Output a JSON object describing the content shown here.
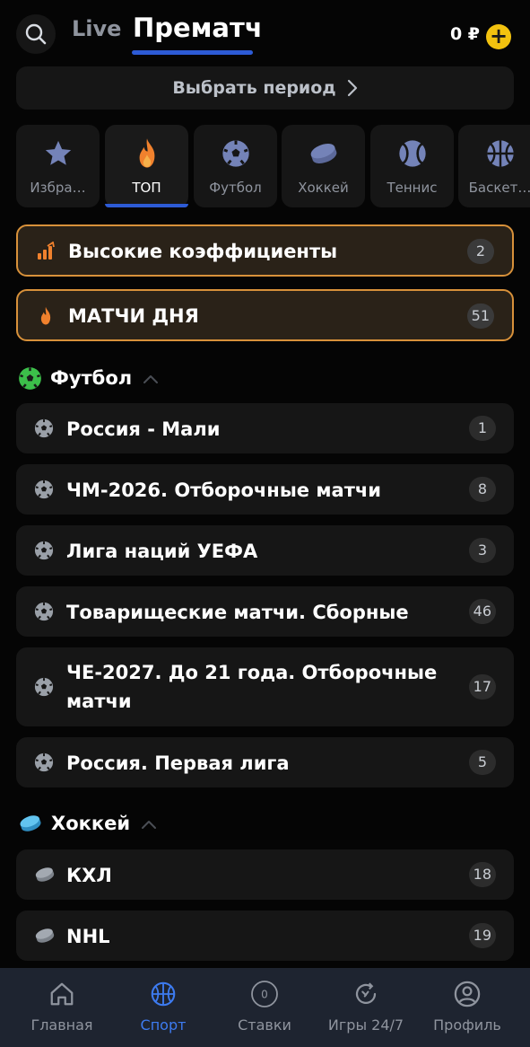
{
  "header": {
    "tabs": [
      {
        "label": "Live",
        "active": false
      },
      {
        "label": "Прематч",
        "active": true
      }
    ],
    "balance": "0 ₽",
    "accent_color": "#2d5bd6",
    "plus_color": "#f2c20f"
  },
  "period": {
    "label": "Выбрать период"
  },
  "sports": [
    {
      "label": "Избра…",
      "icon": "star-icon",
      "active": false
    },
    {
      "label": "ТОП",
      "icon": "flame-icon",
      "active": true
    },
    {
      "label": "Футбол",
      "icon": "soccer-ball-icon",
      "active": false
    },
    {
      "label": "Хоккей",
      "icon": "hockey-puck-icon",
      "active": false
    },
    {
      "label": "Теннис",
      "icon": "tennis-ball-icon",
      "active": false
    },
    {
      "label": "Баскет…",
      "icon": "basketball-icon",
      "active": false
    }
  ],
  "highlights": [
    {
      "label": "Высокие коэффициенты",
      "count": "2",
      "icon": "bar-chart-icon"
    },
    {
      "label": "МАТЧИ ДНЯ",
      "count": "51",
      "icon": "flame-icon"
    }
  ],
  "sections": [
    {
      "title": "Футбол",
      "icon": "soccer-ball-icon",
      "items": [
        {
          "label": "Россия - Мали",
          "count": "1"
        },
        {
          "label": "ЧМ-2026. Отборочные матчи",
          "count": "8"
        },
        {
          "label": "Лига наций УЕФА",
          "count": "3"
        },
        {
          "label": "Товарищеские матчи. Сборные",
          "count": "46"
        },
        {
          "label": "ЧЕ-2027. До 21 года. Отборочные матчи",
          "count": "17"
        },
        {
          "label": "Россия. Первая лига",
          "count": "5"
        }
      ]
    },
    {
      "title": "Хоккей",
      "icon": "hockey-puck-icon",
      "items": [
        {
          "label": "КХЛ",
          "count": "18"
        },
        {
          "label": "NHL",
          "count": "19"
        }
      ]
    }
  ],
  "nav": [
    {
      "label": "Главная",
      "icon": "home-icon",
      "active": false
    },
    {
      "label": "Спорт",
      "icon": "basketball-icon",
      "active": true
    },
    {
      "label": "Ставки",
      "icon": "bets-icon",
      "badge": "0",
      "active": false
    },
    {
      "label": "Игры 24/7",
      "icon": "games-24-7-icon",
      "active": false
    },
    {
      "label": "Профиль",
      "icon": "profile-icon",
      "active": false
    }
  ]
}
